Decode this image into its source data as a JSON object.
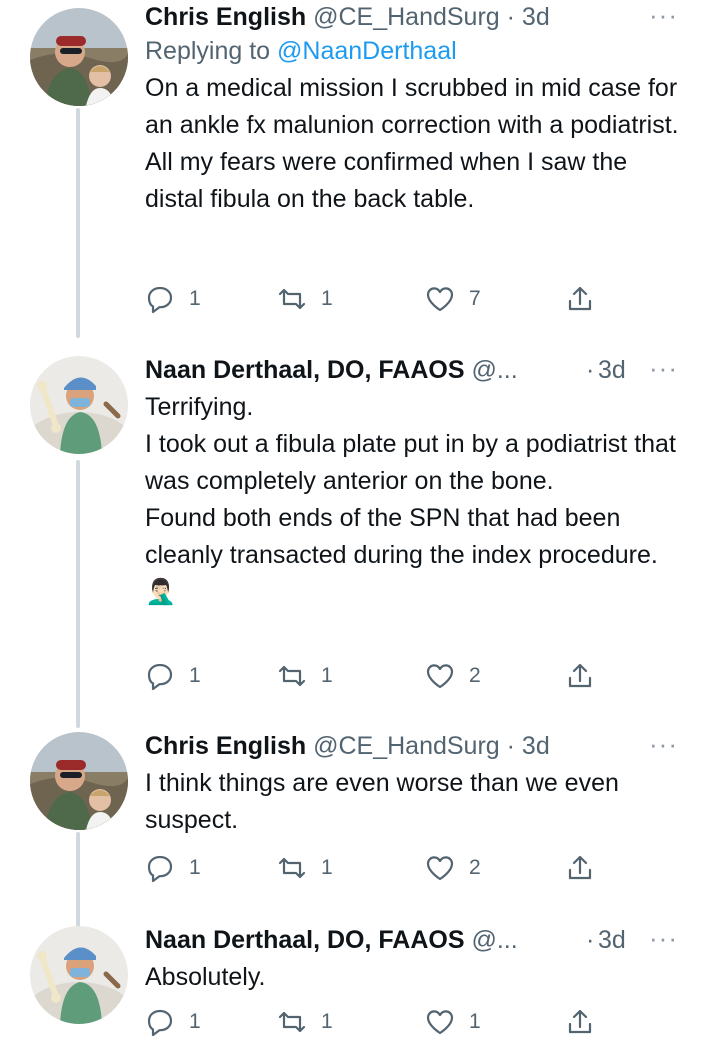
{
  "tweets": [
    {
      "name": "Chris English",
      "handle": "@CE_HandSurg",
      "separator": "·",
      "time": "3d",
      "reply_prefix": "Replying to",
      "reply_to": "@NaanDerthaal",
      "body_lines": [
        "On a medical mission I scrubbed in mid case for an ankle fx malunion correction with a podiatrist. All my fears were confirmed when I saw the distal fibula on the back table."
      ],
      "replies": "1",
      "retweets": "1",
      "likes": "7"
    },
    {
      "name": "Naan Derthaal, DO, FAAOS",
      "handle": "@...",
      "separator": "·",
      "time": "3d",
      "body_lines": [
        "Terrifying.",
        "I took out a fibula plate put in by a podiatrist that was completely anterior on the bone.",
        "Found both ends of the SPN that had been cleanly transacted during the index procedure. 🤦🏻‍♂️"
      ],
      "replies": "1",
      "retweets": "1",
      "likes": "2"
    },
    {
      "name": "Chris English",
      "handle": "@CE_HandSurg",
      "separator": "·",
      "time": "3d",
      "body_lines": [
        "I think things are even worse than we even suspect."
      ],
      "replies": "1",
      "retweets": "1",
      "likes": "2"
    },
    {
      "name": "Naan Derthaal, DO, FAAOS",
      "handle": "@...",
      "separator": "·",
      "time": "3d",
      "body_lines": [
        "Absolutely."
      ],
      "replies": "1",
      "retweets": "1",
      "likes": "1"
    }
  ],
  "more_glyph": "···",
  "icons": {
    "reply": "reply-icon",
    "retweet": "retweet-icon",
    "like": "heart-icon",
    "share": "share-icon"
  },
  "colors": {
    "text": "#0f1419",
    "secondary": "#536471",
    "link": "#1d9bf0",
    "thread_line": "#cfd9de"
  }
}
